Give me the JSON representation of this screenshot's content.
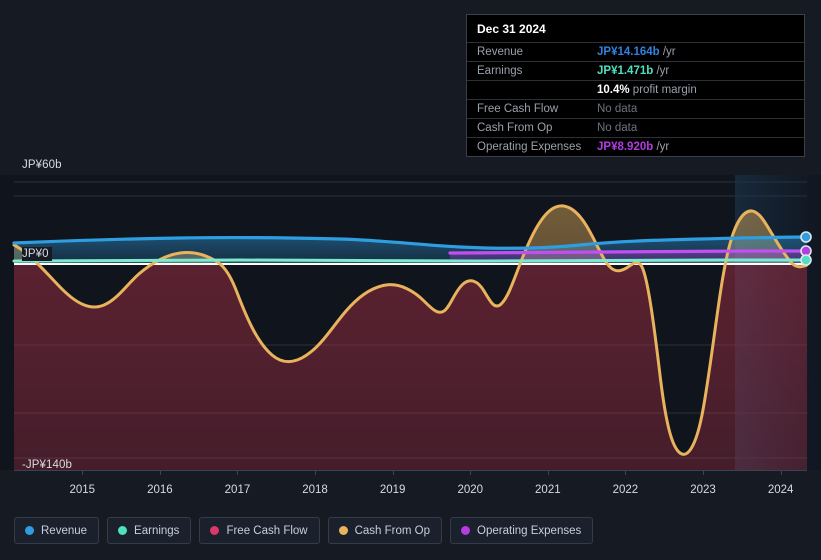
{
  "axis": {
    "y_top_label": "JP¥60b",
    "y_zero_label": "JP¥0",
    "y_bottom_label": "-JP¥140b",
    "x_ticks": [
      "2015",
      "2016",
      "2017",
      "2018",
      "2019",
      "2020",
      "2021",
      "2022",
      "2023",
      "2024"
    ]
  },
  "tooltip": {
    "date": "Dec 31 2024",
    "rows": [
      {
        "label": "Revenue",
        "amount": "JP¥14.164b",
        "unit": "/yr",
        "color": "#2f82e0",
        "no_data": false
      },
      {
        "label": "Earnings",
        "amount": "JP¥1.471b",
        "unit": "/yr",
        "color": "#4fe0c0",
        "no_data": false
      },
      {
        "label": "",
        "amount": "10.4%",
        "unit": "profit margin",
        "color": "#ffffff",
        "no_data": false
      },
      {
        "label": "Free Cash Flow",
        "amount": "No data",
        "unit": "",
        "color": "#6d737e",
        "no_data": true
      },
      {
        "label": "Cash From Op",
        "amount": "No data",
        "unit": "",
        "color": "#6d737e",
        "no_data": true
      },
      {
        "label": "Operating Expenses",
        "amount": "JP¥8.920b",
        "unit": "/yr",
        "color": "#b43ce0",
        "no_data": false
      }
    ]
  },
  "legend": {
    "items": [
      {
        "label": "Revenue",
        "color": "#2f9ee0"
      },
      {
        "label": "Earnings",
        "color": "#4fe0c0"
      },
      {
        "label": "Free Cash Flow",
        "color": "#d8386b"
      },
      {
        "label": "Cash From Op",
        "color": "#e8b35c"
      },
      {
        "label": "Operating Expenses",
        "color": "#b43ce0"
      }
    ]
  },
  "chart_data": {
    "type": "area",
    "title": "",
    "xlabel": "",
    "ylabel": "JP¥",
    "ylim": [
      -140,
      60
    ],
    "y_ticks": [
      60,
      0,
      -140
    ],
    "grid": true,
    "legend_position": "bottom",
    "x": [
      "2014.3",
      "2015",
      "2016",
      "2017",
      "2018",
      "2019",
      "2020",
      "2021",
      "2022",
      "2023",
      "2024",
      "2024.8"
    ],
    "currency": "JP¥",
    "units": "billions",
    "forecast_start": "2024.3",
    "series": [
      {
        "name": "Revenue",
        "color": "#2f9ee0",
        "values": [
          11.5,
          12.0,
          13.0,
          13.5,
          13.0,
          13.2,
          12.2,
          12.0,
          13.5,
          13.0,
          14.164,
          14.164
        ]
      },
      {
        "name": "Earnings",
        "color": "#4fe0c0",
        "values": [
          0.6,
          0.8,
          1.0,
          0.9,
          0.7,
          0.8,
          0.5,
          0.6,
          1.0,
          1.2,
          1.471,
          1.471
        ]
      },
      {
        "name": "Free Cash Flow",
        "color": "#d8386b",
        "values": [
          null,
          null,
          null,
          null,
          null,
          null,
          null,
          null,
          null,
          null,
          null,
          null
        ]
      },
      {
        "name": "Cash From Op",
        "color": "#e8b35c",
        "values": [
          12.0,
          -6.0,
          18.0,
          -28.0,
          -32.0,
          -12.0,
          2.0,
          38.0,
          10.0,
          -118.0,
          30.0,
          12.0
        ]
      },
      {
        "name": "Operating Expenses",
        "color": "#b43ce0",
        "values": [
          null,
          null,
          null,
          null,
          null,
          null,
          7.5,
          7.8,
          8.2,
          8.5,
          8.92,
          8.92
        ]
      }
    ]
  }
}
